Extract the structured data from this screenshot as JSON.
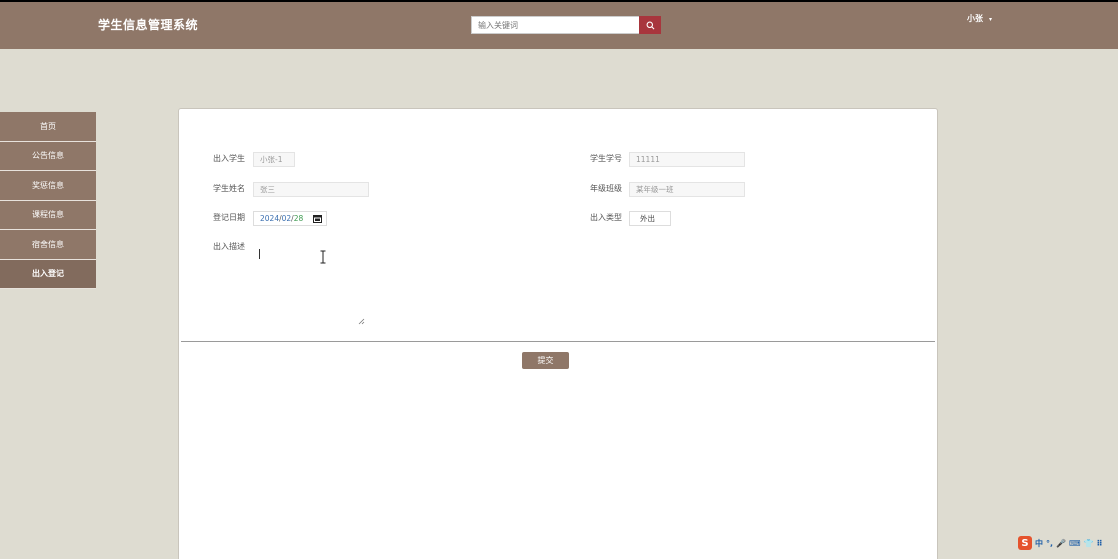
{
  "header": {
    "app_title": "学生信息管理系统",
    "search_placeholder": "输入关键词",
    "user_name": "小张",
    "user_caret": "▾"
  },
  "sidebar": {
    "items": [
      {
        "label": "首页"
      },
      {
        "label": "公告信息"
      },
      {
        "label": "奖惩信息"
      },
      {
        "label": "课程信息"
      },
      {
        "label": "宿舍信息"
      },
      {
        "label": "出入登记"
      }
    ],
    "active_index": 5
  },
  "form": {
    "student_label": "出入学生",
    "student_value": "小张-1",
    "student_no_label": "学生学号",
    "student_no_value": "11111",
    "name_label": "学生姓名",
    "name_value": "张三",
    "grade_label": "年级班级",
    "grade_value": "某年级一班",
    "date_label": "登记日期",
    "date_year": "2024",
    "date_sep": "/",
    "date_month": "02",
    "date_day": "28",
    "type_label": "出入类型",
    "type_value": "外出",
    "desc_label": "出入描述",
    "submit_label": "提交"
  },
  "ime": {
    "logo": "S",
    "items": [
      "中",
      "°,",
      "🎤",
      "⌨",
      "👕",
      "⠿"
    ]
  },
  "colors": {
    "brand": "#8f7768",
    "search_button": "#a8363d",
    "background": "#dedcd1"
  }
}
